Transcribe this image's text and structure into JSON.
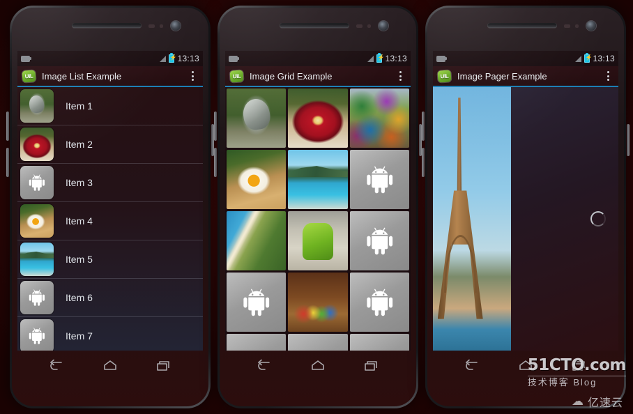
{
  "background": {
    "color": "#2d0707"
  },
  "accent": {
    "actionbar_underline": "#1b7fb5",
    "battery": "#1fc6e8",
    "logo_green": "#6cae28"
  },
  "phones": [
    {
      "id": "phone-list",
      "statusbar": {
        "time": "13:13",
        "notification_icon": "message-icon",
        "signal_icon": "signal-triangle-icon",
        "battery_icon": "battery-charging-icon"
      },
      "actionbar": {
        "logo": "uil-logo",
        "logo_text": "UIL",
        "title": "Image List Example",
        "overflow_icon": "overflow-menu-icon"
      },
      "variant": "list",
      "list_items": [
        {
          "label": "Item 1",
          "image": "sculpture"
        },
        {
          "label": "Item 2",
          "image": "flowers"
        },
        {
          "label": "Item 3",
          "image": "android-placeholder"
        },
        {
          "label": "Item 4",
          "image": "egg"
        },
        {
          "label": "Item 5",
          "image": "beach"
        },
        {
          "label": "Item 6",
          "image": "android-placeholder"
        },
        {
          "label": "Item 7",
          "image": "android-placeholder"
        }
      ]
    },
    {
      "id": "phone-grid",
      "statusbar": {
        "time": "13:13",
        "notification_icon": "message-icon",
        "signal_icon": "signal-triangle-icon",
        "battery_icon": "battery-charging-icon"
      },
      "actionbar": {
        "logo": "uil-logo",
        "logo_text": "UIL",
        "title": "Image Grid Example",
        "overflow_icon": "overflow-menu-icon"
      },
      "variant": "grid",
      "grid_columns": 3,
      "grid_cells": [
        "sculpture",
        "flowers",
        "market",
        "egg",
        "beach",
        "android-placeholder",
        "coast",
        "droid-statue",
        "android-placeholder",
        "android-placeholder",
        "toys",
        "android-placeholder",
        "android-placeholder",
        "android-placeholder",
        "android-placeholder"
      ]
    },
    {
      "id": "phone-pager",
      "statusbar": {
        "time": "13:13",
        "notification_icon": "message-icon",
        "signal_icon": "signal-triangle-icon",
        "battery_icon": "battery-charging-icon"
      },
      "actionbar": {
        "logo": "uil-logo",
        "logo_text": "UIL",
        "title": "Image Pager Example",
        "overflow_icon": "overflow-menu-icon"
      },
      "variant": "pager",
      "pager": {
        "current_image": "eiffel-tower",
        "loading_indicator": "loading-spinner"
      }
    }
  ],
  "navbar": {
    "back_icon": "back-arrow-icon",
    "home_icon": "home-icon",
    "recents_icon": "recent-apps-icon"
  },
  "watermarks": {
    "primary": "51CTO.com",
    "primary_sub": "技术博客  Blog",
    "secondary": "亿速云",
    "secondary_icon": "cloud-logo-icon"
  }
}
